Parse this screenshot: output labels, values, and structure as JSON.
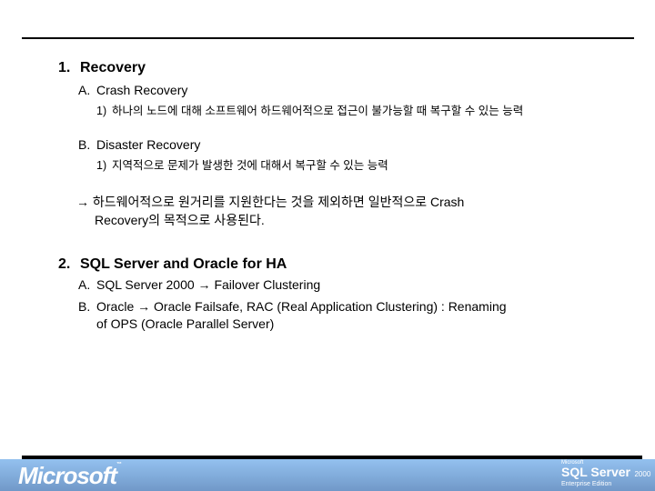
{
  "slide": {
    "sections": [
      {
        "number": "1.",
        "title": "Recovery",
        "items": [
          {
            "marker": "A.",
            "label": "Crash Recovery",
            "sub": [
              {
                "marker": "1)",
                "text": "하나의 노드에 대해 소프트웨어 하드웨어적으로 접근이 불가능할 때 복구할 수 있는 능력"
              }
            ]
          },
          {
            "marker": "B.",
            "label": "Disaster Recovery",
            "sub": [
              {
                "marker": "1)",
                "text": "지역적으로 문제가 발생한 것에 대해서 복구할 수 있는 능력"
              }
            ]
          }
        ],
        "note": {
          "arrow": "→",
          "line1": "하드웨어적으로 원거리를 지원한다는 것을 제외하면 일반적으로 Crash",
          "line2": "Recovery의 목적으로 사용된다."
        }
      },
      {
        "number": "2.",
        "title": "SQL Server and Oracle for HA",
        "items": [
          {
            "marker": "A.",
            "before": "SQL Server 2000",
            "arrow": "→",
            "after": "Failover Clustering"
          },
          {
            "marker": "B.",
            "before": "Oracle",
            "arrow": "→",
            "after": "Oracle Failsafe, RAC (Real Application Clustering) : Renaming",
            "line2": "of OPS (Oracle Parallel Server)"
          }
        ]
      }
    ]
  },
  "footer": {
    "left_logo": "Microsoft",
    "right_logo": {
      "top": "Microsoft",
      "product": "SQL Server",
      "version": "2000",
      "edition": "Enterprise Edition"
    },
    "band_color": "#7fa9d8"
  }
}
